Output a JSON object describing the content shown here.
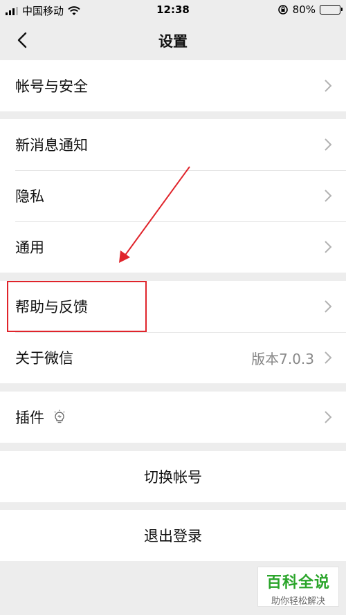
{
  "status_bar": {
    "carrier": "中国移动",
    "time": "12:38",
    "battery": "80%",
    "battery_level": 0.8
  },
  "nav": {
    "title": "设置",
    "back_icon": "chevron-left-icon"
  },
  "groups": [
    {
      "rows": [
        {
          "label": "帐号与安全"
        }
      ]
    },
    {
      "rows": [
        {
          "label": "新消息通知"
        },
        {
          "label": "隐私"
        },
        {
          "label": "通用"
        }
      ]
    },
    {
      "rows": [
        {
          "label": "帮助与反馈"
        },
        {
          "label": "关于微信",
          "value": "版本7.0.3"
        }
      ]
    },
    {
      "rows": [
        {
          "label": "插件",
          "icon": "lightbulb-icon"
        }
      ]
    }
  ],
  "actions": {
    "switch_account": "切换帐号",
    "logout": "退出登录"
  },
  "annotation": {
    "color": "#e0242b"
  },
  "watermark": {
    "main": "百科全说",
    "sub": "助你轻松解决"
  }
}
